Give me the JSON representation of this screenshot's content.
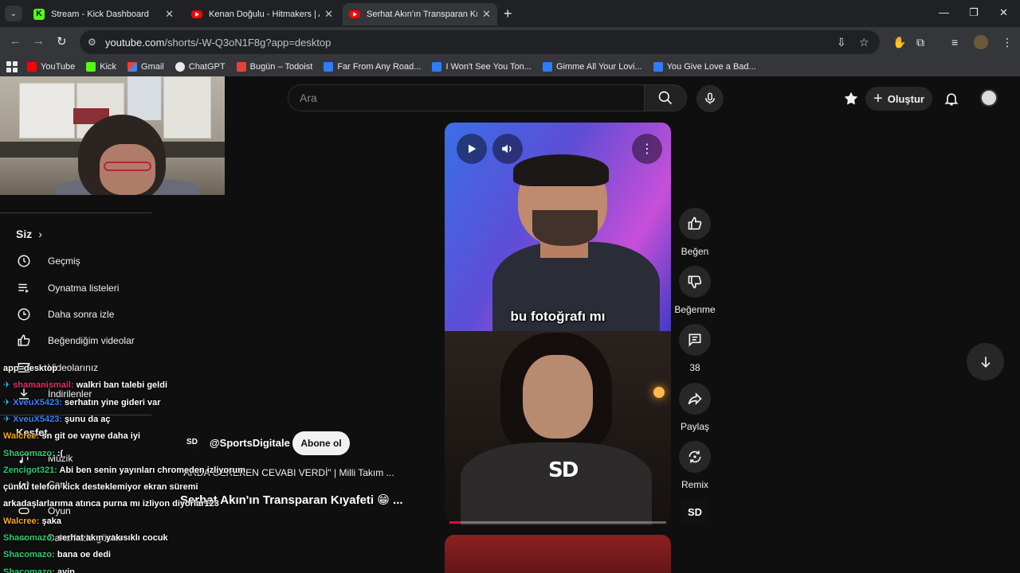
{
  "browser": {
    "tabs": [
      {
        "title": "Stream - Kick Dashboard",
        "favicon": "kick-icon",
        "active": false
      },
      {
        "title": "Kenan Doğulu - Hitmakers | Ara",
        "favicon": "youtube-icon",
        "active": false
      },
      {
        "title": "Serhat Akın'ın Transparan Kıyafe",
        "favicon": "youtube-icon",
        "active": true
      }
    ],
    "url_host": "youtube.com",
    "url_path": "/shorts/-W-Q3oN1F8g?app=desktop",
    "bookmarks": [
      "YouTube",
      "Kick",
      "Gmail",
      "ChatGPT",
      "Bugün – Todoist",
      "Far From Any Road...",
      "I Won't See You Ton...",
      "Gimme All Your Lovi...",
      "You Give Love a Bad..."
    ]
  },
  "youtube": {
    "search_placeholder": "Ara",
    "create_label": "Oluştur",
    "sidebar": {
      "section_title": "Siz",
      "items": [
        "Geçmiş",
        "Oynatma listeleri",
        "Daha sonra izle",
        "Beğendiğim videolar",
        "Videolarınız",
        "İndirilenler"
      ],
      "explore_title": "Keşfet",
      "explore_items": [
        "Müzik",
        "Canlı",
        "Oyun",
        "Daha fazla göster"
      ]
    },
    "short": {
      "subtitle": "bu fotoğrafı mı",
      "channel": "@SportsDigitale",
      "channel_logo": "SD",
      "subscribe_label": "Abone ol",
      "description": "\"ARDA GEREKEN CEVABI VERDİ\" | Milli Takım ...",
      "title": "Serhat Akın'ın Transparan Kıyafeti 😁 ...",
      "progress": 0.05
    },
    "actions": {
      "like": "Beğen",
      "dislike": "Beğenme",
      "comments": "38",
      "share": "Paylaş",
      "remix": "Remix"
    }
  },
  "chat": [
    {
      "user": "",
      "text": "app=desktop",
      "user_color": "#ffffff",
      "pinned": false
    },
    {
      "user": "shamanismail:",
      "text": "walkri ban talebi geldi",
      "user_color": "#e1306c",
      "pinned": true
    },
    {
      "user": "XveuX5423:",
      "text": "serhatın yine gideri var",
      "user_color": "#3b82f6",
      "pinned": true
    },
    {
      "user": "XveuX5423:",
      "text": "şunu da aç",
      "user_color": "#3b82f6",
      "pinned": true
    },
    {
      "user": "Walcree:",
      "text": "sn git oe vayne daha iyi",
      "user_color": "#f5a623",
      "pinned": false
    },
    {
      "user": "Shacomazo:",
      "text": ":(",
      "user_color": "#2ecc71",
      "pinned": false
    },
    {
      "user": "Zencigot321:",
      "text": "Abi ben senin yayınları chromeden izliyorum",
      "user_color": "#2ecc71",
      "pinned": false
    },
    {
      "user": "",
      "text": "çünkü telefon kick desteklemiyor ekran süremi",
      "user_color": "#ffffff",
      "pinned": false
    },
    {
      "user": "",
      "text": "arkadaşlarlarıma atınca purna mı izliyon diyorlar123",
      "user_color": "#ffffff",
      "pinned": false
    },
    {
      "user": "Walcree:",
      "text": "şaka",
      "user_color": "#f5a623",
      "pinned": false
    },
    {
      "user": "Shacomazo:",
      "text": "serhat akın yakısıklı cocuk",
      "user_color": "#2ecc71",
      "pinned": false
    },
    {
      "user": "Shacomazo:",
      "text": "bana oe dedi",
      "user_color": "#2ecc71",
      "pinned": false
    },
    {
      "user": "Shacomazo:",
      "text": "ayip",
      "user_color": "#2ecc71",
      "pinned": false
    }
  ]
}
